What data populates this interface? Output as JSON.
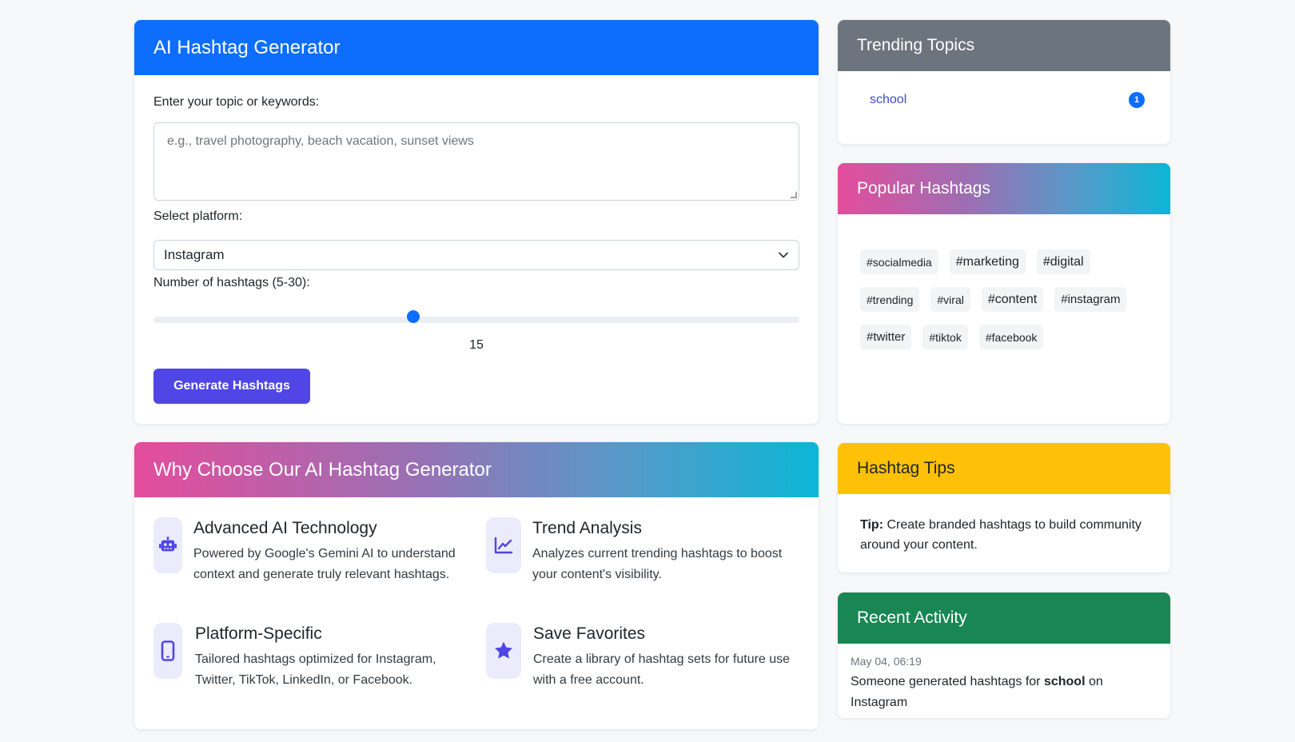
{
  "generator": {
    "title": "AI Hashtag Generator",
    "topic_label": "Enter your topic or keywords:",
    "topic_placeholder": "e.g., travel photography, beach vacation, sunset views",
    "platform_label": "Select platform:",
    "platform_value": "Instagram",
    "count_label": "Number of hashtags (5-30):",
    "count_value": "15",
    "count_min": 5,
    "count_max": 30,
    "generate_button": "Generate Hashtags"
  },
  "features": {
    "title": "Why Choose Our AI Hashtag Generator",
    "items": [
      {
        "icon": "robot-icon",
        "title": "Advanced AI Technology",
        "desc": "Powered by Google's Gemini AI to understand context and generate truly relevant hashtags."
      },
      {
        "icon": "chart-line-icon",
        "title": "Trend Analysis",
        "desc": "Analyzes current trending hashtags to boost your content's visibility."
      },
      {
        "icon": "mobile-icon",
        "title": "Platform-Specific",
        "desc": "Tailored hashtags optimized for Instagram, Twitter, TikTok, LinkedIn, or Facebook."
      },
      {
        "icon": "star-icon",
        "title": "Save Favorites",
        "desc": "Create a library of hashtag sets for future use with a free account."
      }
    ]
  },
  "trending": {
    "title": "Trending Topics",
    "topics": [
      {
        "name": "school",
        "count": "1"
      }
    ]
  },
  "popular": {
    "title": "Popular Hashtags",
    "tags": [
      "#socialmedia",
      "#marketing",
      "#digital",
      "#trending",
      "#viral",
      "#content",
      "#instagram",
      "#twitter",
      "#tiktok",
      "#facebook"
    ]
  },
  "tips": {
    "title": "Hashtag Tips",
    "tip_label": "Tip:",
    "tip_text": "Create branded hashtags to build community around your content."
  },
  "activity": {
    "title": "Recent Activity",
    "time": "May 04, 06:19",
    "text_before": "Someone generated hashtags for",
    "topic": "school",
    "text_middle": "on",
    "platform": "Instagram"
  },
  "colors": {
    "primary": "#0d6efd",
    "button": "#4f46e5",
    "trending_header": "#6c757d",
    "tips_header": "#ffc107",
    "activity_header": "#198754",
    "gradient_start": "#e44d9c",
    "gradient_end": "#0cb6d6"
  }
}
